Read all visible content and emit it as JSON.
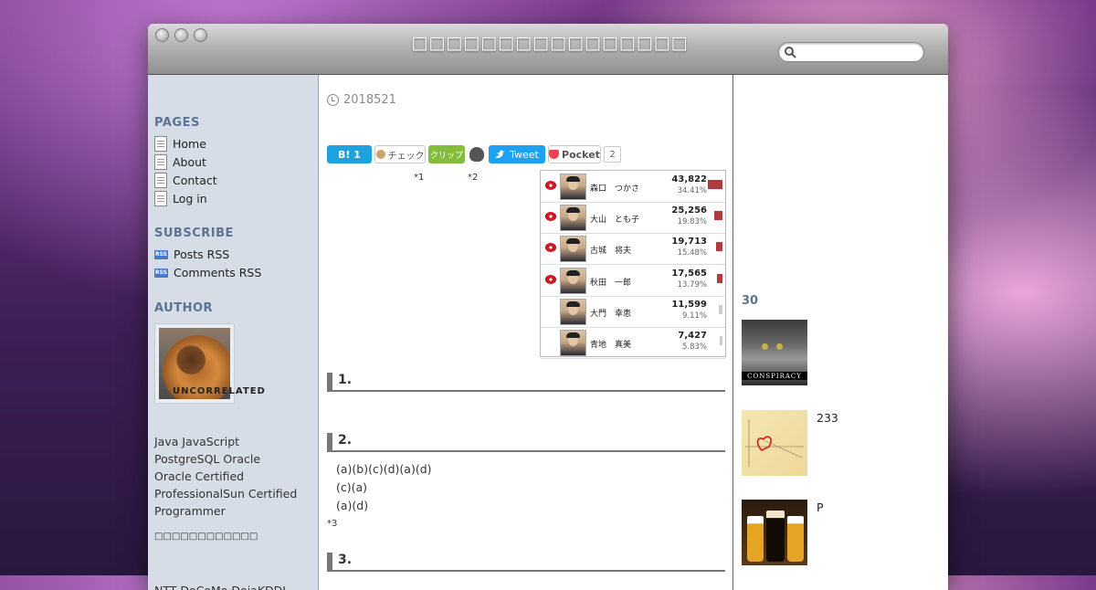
{
  "window": {
    "title": "□□□□□□□□□□□□□□□□",
    "search_placeholder": ""
  },
  "sidebar": {
    "pages_heading": "PAGES",
    "pages": [
      "Home",
      "About",
      "Contact",
      "Log in"
    ],
    "subscribe_heading": "SUBSCRIBE",
    "feeds": [
      "Posts RSS",
      "Comments RSS"
    ],
    "author_heading": "AUTHOR",
    "author_name": "UNCORRELATED",
    "bio_lines": [
      "Java JavaScript",
      "PostgreSQL Oracle",
      "Oracle Certified",
      "ProfessionalSun Certified",
      "Programmer"
    ],
    "bio_jp": "□□□□□□□□□□□□",
    "footer_text": "NTT DoCoMo DojaKDDI"
  },
  "post": {
    "date": "2018521",
    "share": {
      "hatena": "B! 1",
      "mixi": "チェック",
      "clip": "クリップ",
      "tweet": "Tweet",
      "pocket": "Pocket",
      "pocket_count": "2"
    },
    "footnote_1": "*1",
    "footnote_2": "*2",
    "heading_1": "1.",
    "heading_2": "2.",
    "lines": [
      "(a)(b)(c)(d)(a)(d)",
      "(c)(a)",
      "(a)(d)"
    ],
    "footnote_3": "*3",
    "heading_3": "3."
  },
  "results": [
    {
      "name": "森口　つかさ",
      "votes": "43,822",
      "pct": "34.41%",
      "elected": true,
      "share": 34.41
    },
    {
      "name": "大山　とも子",
      "votes": "25,256",
      "pct": "19.83%",
      "elected": true,
      "share": 19.83
    },
    {
      "name": "古城　将夫",
      "votes": "19,713",
      "pct": "15.48%",
      "elected": true,
      "share": 15.48
    },
    {
      "name": "秋田　一郎",
      "votes": "17,565",
      "pct": "13.79%",
      "elected": true,
      "share": 13.79
    },
    {
      "name": "大門　幸恵",
      "votes": "11,599",
      "pct": "9.11%",
      "elected": false,
      "share": 9.11
    },
    {
      "name": "青地　真美",
      "votes": "7,427",
      "pct": "5.83%",
      "elected": false,
      "share": 5.83
    }
  ],
  "colors": {
    "elected_bar": "#b23a3a",
    "lost_bar": "#cccccc",
    "heading": "#5d7392"
  },
  "right": {
    "heading": "30",
    "items": [
      {
        "caption": "CONSPIRACY",
        "text": ""
      },
      {
        "caption": "",
        "text": "233"
      },
      {
        "caption": "",
        "text": "P"
      }
    ]
  }
}
